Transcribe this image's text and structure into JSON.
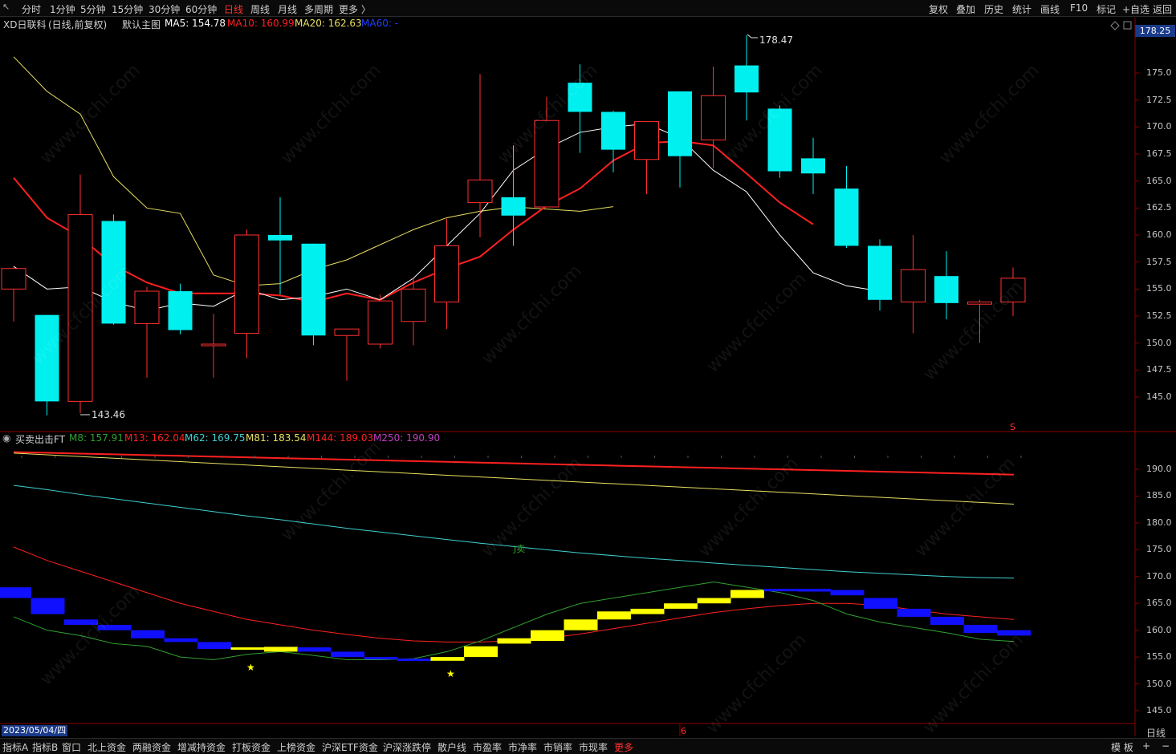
{
  "topbar": {
    "periods": [
      "分时",
      "1分钟",
      "5分钟",
      "15分钟",
      "30分钟",
      "60分钟",
      "日线",
      "周线",
      "月线",
      "多周期",
      "更多 〉"
    ],
    "active": "日线",
    "right_buttons": [
      "复权",
      "叠加",
      "历史",
      "统计",
      "画线",
      "F10",
      "标记",
      "+自选",
      "返回"
    ]
  },
  "info": {
    "stock": "XD日联科",
    "mode": "(日线,前复权)",
    "chart_name": "默认主图",
    "ma5_label": "MA5: 154.78",
    "ma10_label": "MA10: 160.99",
    "ma20_label": "MA20: 162.63",
    "ma60_label": "MA60: -"
  },
  "current_price": "178.25",
  "annot_high": "178.47",
  "annot_low": "143.46",
  "main_axis": [
    "175.0",
    "172.5",
    "170.0",
    "167.5",
    "165.0",
    "162.5",
    "160.0",
    "157.5",
    "155.0",
    "152.5",
    "150.0",
    "147.5",
    "145.0"
  ],
  "sub_info": {
    "name": "买卖出击FT",
    "m8": "M8: 157.91",
    "m13": "M13: 162.04",
    "m62": "M62: 169.75",
    "m81": "M81: 183.54",
    "m144": "M144: 189.03",
    "m250": "M250: 190.90"
  },
  "sub_axis": [
    "190.0",
    "185.0",
    "180.0",
    "175.0",
    "170.0",
    "165.0",
    "160.0",
    "155.0",
    "150.0",
    "145.0"
  ],
  "sub_signal": "J卖",
  "marker_s": "S",
  "date": "2023/05/04/四",
  "month_mark": "6",
  "period_label": "日线",
  "bottom_tabs": [
    "指标A",
    "指标B",
    "窗口",
    "北上资金",
    "两融资金",
    "增减持资金",
    "打板资金",
    "上榜资金",
    "沪深ETF资金",
    "沪深涨跌停",
    "散户线",
    "市盈率",
    "市净率",
    "市销率",
    "市现率",
    "更多"
  ],
  "bottom_right": [
    "模 板",
    "+",
    "−"
  ],
  "watermark": "www.cfchi.com",
  "colors": {
    "up": "#ff3030",
    "down": "#00f0f0",
    "ma5": "#ffffff",
    "ma10": "#ff2020",
    "ma20": "#e8e060",
    "ma60": "#2040ff",
    "m8": "#30a030",
    "m13": "#ff2020",
    "m62": "#40d0d0",
    "m81": "#e8e060",
    "m144": "#ff2020",
    "m250": "#c040c0"
  },
  "chart_data": {
    "type": "candlestick",
    "ylim": [
      142.5,
      180.0
    ],
    "candles": [
      {
        "o": 155.0,
        "h": 157.0,
        "l": 152.0,
        "c": 156.9
      },
      {
        "o": 152.6,
        "h": 152.6,
        "l": 143.3,
        "c": 144.6
      },
      {
        "o": 144.6,
        "h": 165.6,
        "l": 143.5,
        "c": 161.9
      },
      {
        "o": 161.3,
        "h": 161.9,
        "l": 151.7,
        "c": 151.8
      },
      {
        "o": 151.8,
        "h": 155.2,
        "l": 146.8,
        "c": 154.8
      },
      {
        "o": 154.8,
        "h": 155.5,
        "l": 150.8,
        "c": 151.2
      },
      {
        "o": 149.9,
        "h": 152.7,
        "l": 146.8,
        "c": 149.9
      },
      {
        "o": 150.9,
        "h": 160.5,
        "l": 148.6,
        "c": 160.0
      },
      {
        "o": 160.0,
        "h": 163.5,
        "l": 154.5,
        "c": 159.5
      },
      {
        "o": 159.2,
        "h": 159.2,
        "l": 149.8,
        "c": 150.7
      },
      {
        "o": 150.7,
        "h": 151.2,
        "l": 146.5,
        "c": 151.3
      },
      {
        "o": 149.9,
        "h": 154.5,
        "l": 149.5,
        "c": 153.9
      },
      {
        "o": 152.0,
        "h": 156.0,
        "l": 149.8,
        "c": 155.0
      },
      {
        "o": 153.8,
        "h": 161.5,
        "l": 151.3,
        "c": 159.0
      },
      {
        "o": 163.0,
        "h": 174.9,
        "l": 159.8,
        "c": 165.1
      },
      {
        "o": 163.5,
        "h": 168.3,
        "l": 159.0,
        "c": 161.8
      },
      {
        "o": 162.6,
        "h": 172.8,
        "l": 162.6,
        "c": 170.6
      },
      {
        "o": 174.1,
        "h": 175.8,
        "l": 167.6,
        "c": 171.4
      },
      {
        "o": 171.4,
        "h": 171.5,
        "l": 165.8,
        "c": 167.9
      },
      {
        "o": 167.0,
        "h": 170.5,
        "l": 163.8,
        "c": 170.5
      },
      {
        "o": 173.3,
        "h": 173.3,
        "l": 164.4,
        "c": 167.3
      },
      {
        "o": 168.8,
        "h": 175.6,
        "l": 166.2,
        "c": 172.9
      },
      {
        "o": 175.7,
        "h": 178.5,
        "l": 170.6,
        "c": 173.2
      },
      {
        "o": 171.7,
        "h": 172.0,
        "l": 165.3,
        "c": 165.9
      },
      {
        "o": 167.1,
        "h": 169.0,
        "l": 163.8,
        "c": 165.7
      },
      {
        "o": 164.3,
        "h": 166.4,
        "l": 158.8,
        "c": 159.0
      },
      {
        "o": 159.0,
        "h": 159.6,
        "l": 153.0,
        "c": 154.0
      },
      {
        "o": 153.8,
        "h": 160.0,
        "l": 150.9,
        "c": 156.8
      },
      {
        "o": 156.2,
        "h": 158.5,
        "l": 152.2,
        "c": 153.7
      },
      {
        "o": 153.6,
        "h": 154.0,
        "l": 150.0,
        "c": 153.8
      },
      {
        "o": 153.8,
        "h": 157.0,
        "l": 152.5,
        "c": 156.0
      }
    ],
    "ma5": [
      157.1,
      155.0,
      155.2,
      153.8,
      153.0,
      153.7,
      153.4,
      155.0,
      154.0,
      154.3,
      155.0,
      154.0,
      156.0,
      159.0,
      162.0,
      166.0,
      168.0,
      169.5,
      170.0,
      170.3,
      169.0,
      166.0,
      164.0,
      160.0,
      156.5,
      155.3,
      154.8
    ],
    "ma10": [
      165.3,
      161.6,
      159.8,
      157.2,
      155.6,
      154.6,
      154.6,
      154.6,
      154.4,
      153.8,
      154.6,
      154.0,
      155.6,
      156.9,
      158.0,
      160.5,
      162.7,
      164.3,
      166.9,
      168.5,
      168.7,
      168.3,
      165.7,
      163.0,
      160.99
    ],
    "ma20": [
      176.5,
      173.3,
      171.2,
      165.4,
      162.5,
      162.0,
      156.3,
      155.3,
      155.5,
      156.8,
      157.7,
      159.1,
      160.5,
      161.6,
      162.2,
      162.6,
      162.4,
      162.2,
      162.63
    ]
  }
}
